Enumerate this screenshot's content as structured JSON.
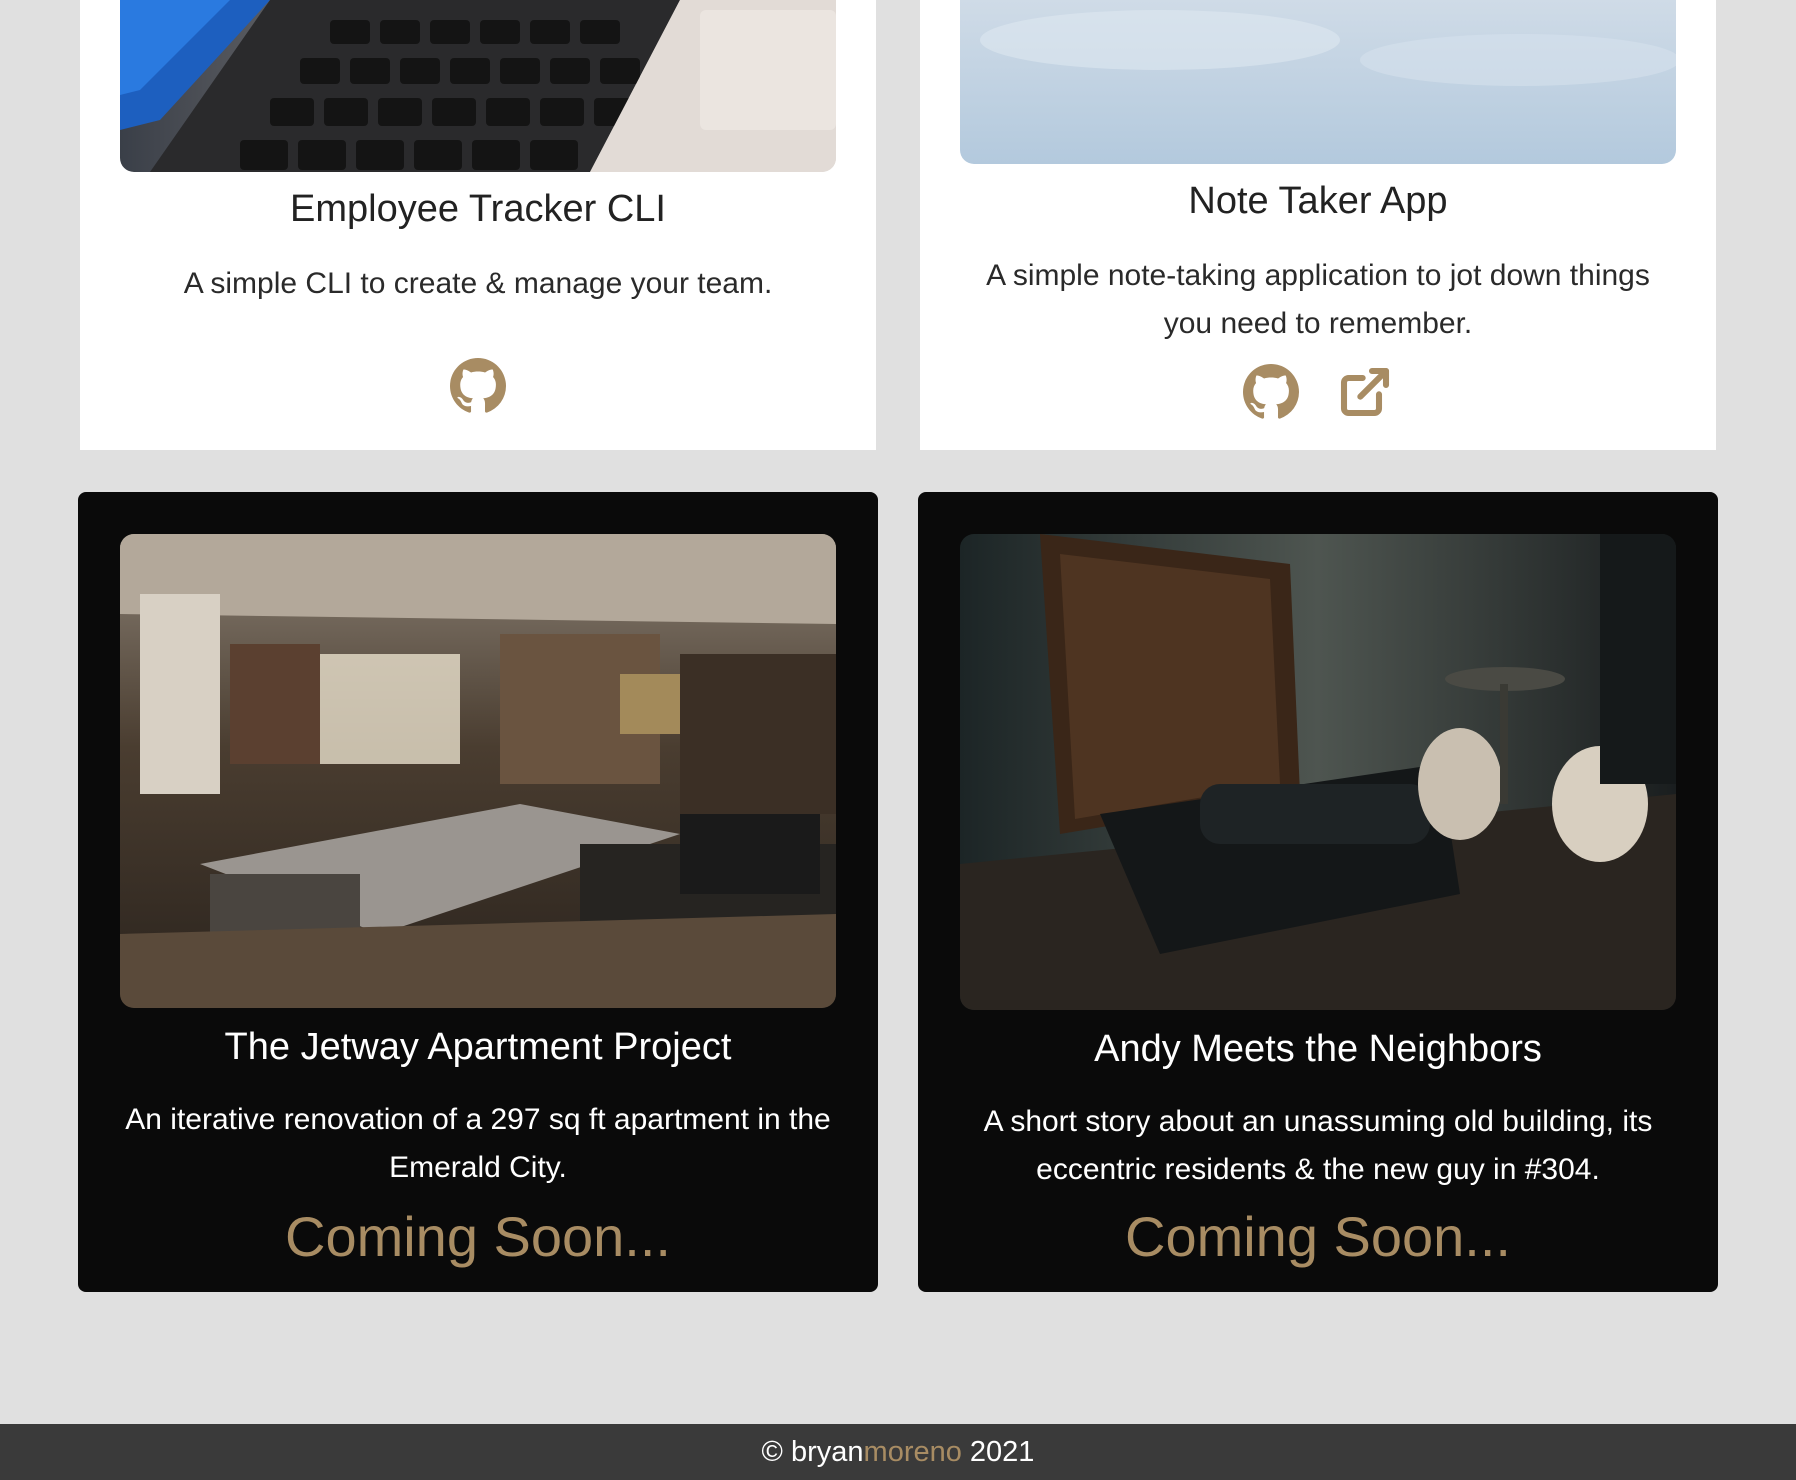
{
  "colors": {
    "page_background": "#e0e0e0",
    "accent": "#a88c63",
    "dark_card": "#0a0a0a",
    "footer_background": "#3a3a3a"
  },
  "cards": [
    {
      "title": "Employee Tracker CLI",
      "description": "A simple CLI to create & manage your team.",
      "image": "laptop-keyboard-photo",
      "links": [
        "github-icon"
      ]
    },
    {
      "title": "Note Taker App",
      "description": "A simple note-taking application to jot down things you need to remember.",
      "image": "sky-photo",
      "links": [
        "github-icon",
        "external-link-icon"
      ]
    },
    {
      "title": "The Jetway Apartment Project",
      "description": "An iterative renovation of a 297 sq ft apartment in the Emerald City.",
      "image": "workshop-photo",
      "status": "Coming Soon..."
    },
    {
      "title": "Andy Meets the Neighbors",
      "description": "A short story about an unassuming old building, its eccentric residents & the new guy in #304.",
      "image": "typewriter-photo",
      "status": "Coming Soon..."
    }
  ],
  "footer": {
    "copyright_symbol": "©",
    "name_first": "bryan",
    "name_last": "moreno",
    "year": "2021"
  }
}
